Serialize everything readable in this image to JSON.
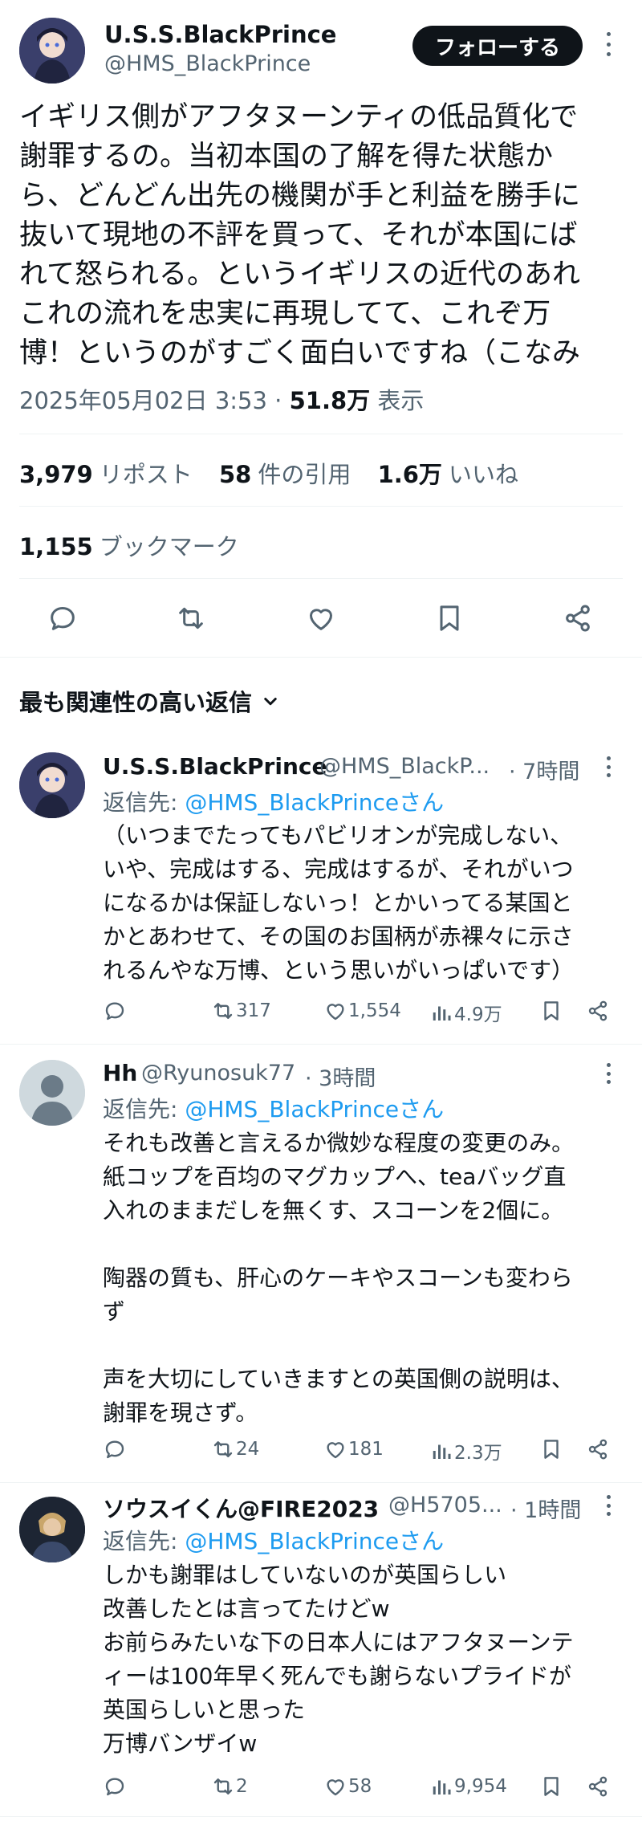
{
  "post": {
    "name": "U.S.S.BlackPrince",
    "handle": "@HMS_BlackPrince",
    "follow_label": "フォローする",
    "text": "イギリス側がアフタヌーンティの低品質化で\n謝罪するの。当初本国の了解を得た状態か\nら、どんどん出先の機関が手と利益を勝手に\n抜いて現地の不評を買って、それが本国にば\nれて怒られる。というイギリスの近代のあれ\nこれの流れを忠実に再現してて、これぞ万\n博！というのがすごく面白いですね（こなみ",
    "timestamp": "2025年05月02日 3:53 · ",
    "views_count": "51.8万",
    "views_label": " 表示",
    "reposts_count": "3,979",
    "reposts_label": "リポスト",
    "quotes_count": "58",
    "quotes_label": "件の引用",
    "likes_count": "1.6万",
    "likes_label": "いいね",
    "bookmarks_count": "1,155",
    "bookmarks_label": "ブックマーク"
  },
  "replies_header": "最も関連性の高い返信",
  "replies": [
    {
      "name": "U.S.S.BlackPrince",
      "handle": "@HMS_BlackP...",
      "time": "· 7時間",
      "reply_prefix": "返信先: ",
      "reply_to": "@HMS_BlackPrinceさん",
      "text": "（いつまでたってもパビリオンが完成しない、\nいや、完成はする、完成はするが、それがいつ\nになるかは保証しないっ！とかいってる某国と\nかとあわせて、その国のお国柄が赤裸々に示さ\nれるんやな万博、という思いがいっぱいです）",
      "reposts": "317",
      "likes": "1,554",
      "views": "4.9万"
    },
    {
      "name": "Hh",
      "handle": "@Ryunosuk77",
      "time": "· 3時間",
      "reply_prefix": "返信先: ",
      "reply_to": "@HMS_BlackPrinceさん",
      "text": "それも改善と言えるか微妙な程度の変更のみ。\n紙コップを百均のマグカップへ、teaバッグ直\n入れのままだしを無くす、スコーンを2個に。\n\n陶器の質も、肝心のケーキやスコーンも変わら\nず\n\n声を大切にしていきますとの英国側の説明は、\n謝罪を現さず。",
      "reposts": "24",
      "likes": "181",
      "views": "2.3万"
    },
    {
      "name": "ソウスイくん@FIRE2023",
      "handle": "@H5705...",
      "time": "· 1時間",
      "reply_prefix": "返信先: ",
      "reply_to": "@HMS_BlackPrinceさん",
      "text": "しかも謝罪はしていないのが英国らしい\n改善したとは言ってたけどw\nお前らみたいな下の日本人にはアフタヌーンテ\nィーは100年早く死んでも謝らないプライドが\n英国らしいと思った\n万博バンザイw",
      "reposts": "2",
      "likes": "58",
      "views": "9,954"
    }
  ],
  "icons": {
    "reply": "speech-bubble-icon",
    "repost": "repost-arrows-icon",
    "like": "heart-icon",
    "bookmark": "bookmark-icon",
    "share": "share-icon",
    "views": "bar-chart-icon",
    "more": "more-dots-icon",
    "chevron": "chevron-down-icon"
  },
  "colors": {
    "text": "#0f1419",
    "secondary": "#536471",
    "link": "#1d9bf0",
    "divider": "#eff3f4",
    "follow_bg": "#0f1419"
  }
}
